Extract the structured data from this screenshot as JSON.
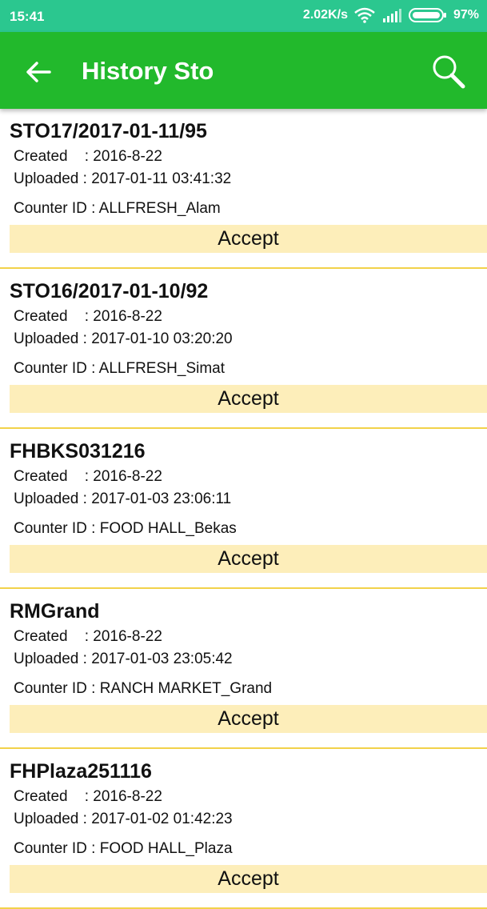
{
  "status_bar": {
    "time": "15:41",
    "speed": "2.02K/s",
    "battery": "97%"
  },
  "app_bar": {
    "title": "History Sto",
    "back_icon": "arrow-left-icon",
    "search_icon": "search-icon"
  },
  "colors": {
    "status_bar": "#2bc78f",
    "app_bar": "#22b92c",
    "accept_bg": "#fdeeba",
    "divider": "#f2d24a"
  },
  "labels": {
    "created": "Created    : ",
    "uploaded": "Uploaded : ",
    "counter": "Counter ID : ",
    "accept": "Accept"
  },
  "items": [
    {
      "name": "STO17/2017-01-11/95",
      "created": "2016-8-22",
      "uploaded": "2017-01-11 03:41:32",
      "counter_id": "ALLFRESH_Alam"
    },
    {
      "name": "STO16/2017-01-10/92",
      "created": "2016-8-22",
      "uploaded": "2017-01-10 03:20:20",
      "counter_id": "ALLFRESH_Simat"
    },
    {
      "name": "FHBKS031216",
      "created": "2016-8-22",
      "uploaded": "2017-01-03 23:06:11",
      "counter_id": "FOOD HALL_Bekas"
    },
    {
      "name": "RMGrand",
      "created": "2016-8-22",
      "uploaded": "2017-01-03 23:05:42",
      "counter_id": "RANCH MARKET_Grand"
    },
    {
      "name": "FHPlaza251116",
      "created": "2016-8-22",
      "uploaded": "2017-01-02 01:42:23",
      "counter_id": "FOOD HALL_Plaza"
    }
  ]
}
